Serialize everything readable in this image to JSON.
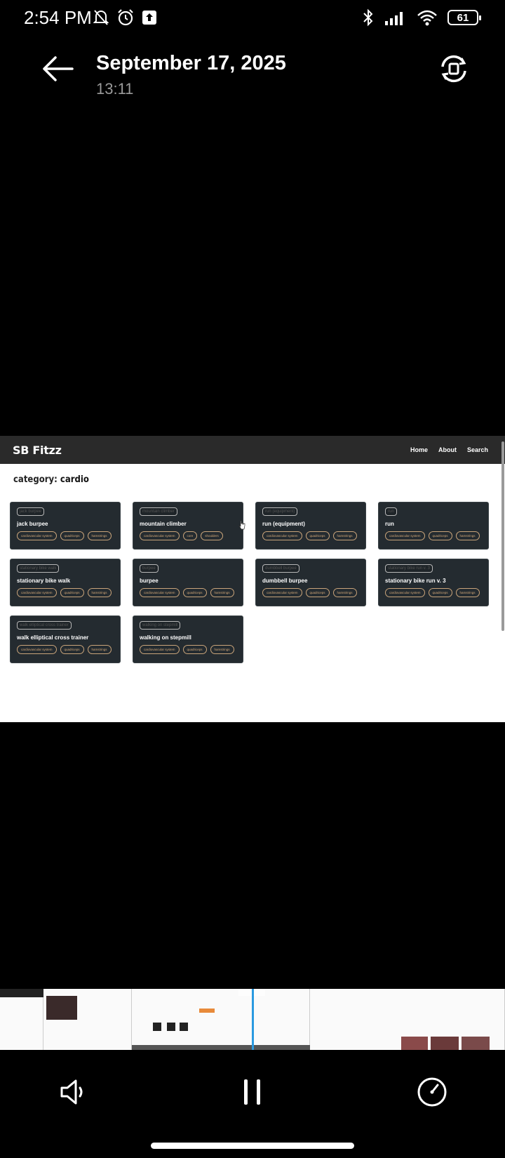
{
  "status_bar": {
    "time": "2:54 PM",
    "battery": "61",
    "icons_left": [
      "mute-bell-icon",
      "alarm-icon",
      "upload-icon"
    ],
    "icons_right": [
      "bluetooth-icon",
      "signal-icon",
      "wifi-icon",
      "battery-icon"
    ]
  },
  "header": {
    "title": "September 17, 2025",
    "subtitle": "13:11",
    "back_icon": "back-arrow-icon",
    "rotate_icon": "rotate-screen-icon"
  },
  "webpage": {
    "brand": "SB Fitzz",
    "nav_links": [
      "Home",
      "About",
      "Search"
    ],
    "category_prefix": "category:",
    "category_name": "cardio",
    "cards": [
      {
        "img_alt": "jack burpee",
        "name": "jack burpee",
        "tags": [
          "cardiovascular system",
          "quadriceps",
          "hamstrings"
        ]
      },
      {
        "img_alt": "mountain climber",
        "name": "mountain climber",
        "tags": [
          "cardiovascular system",
          "core",
          "shoulders"
        ]
      },
      {
        "img_alt": "run (equipment)",
        "name": "run (equipment)",
        "tags": [
          "cardiovascular system",
          "quadriceps",
          "hamstrings"
        ]
      },
      {
        "img_alt": "run",
        "name": "run",
        "tags": [
          "cardiovascular system",
          "quadriceps",
          "hamstrings"
        ]
      },
      {
        "img_alt": "stationary bike walk",
        "name": "stationary bike walk",
        "tags": [
          "cardiovascular system",
          "quadriceps",
          "hamstrings"
        ]
      },
      {
        "img_alt": "burpee",
        "name": "burpee",
        "tags": [
          "cardiovascular system",
          "quadriceps",
          "hamstrings"
        ]
      },
      {
        "img_alt": "dumbbell burpee",
        "name": "dumbbell burpee",
        "tags": [
          "cardiovascular system",
          "quadriceps",
          "hamstrings"
        ]
      },
      {
        "img_alt": "stationary bike run v. 3",
        "name": "stationary bike run v. 3",
        "tags": [
          "cardiovascular system",
          "quadriceps",
          "hamstrings"
        ]
      },
      {
        "img_alt": "walk elliptical cross trainer",
        "name": "walk elliptical cross trainer",
        "tags": [
          "cardiovascular system",
          "quadriceps",
          "hamstrings"
        ]
      },
      {
        "img_alt": "walking on stepmill",
        "name": "walking on stepmill",
        "tags": [
          "cardiovascular system",
          "quadriceps",
          "hamstrings"
        ]
      }
    ]
  },
  "controls": {
    "mute_icon": "speaker-icon",
    "pause_icon": "pause-icon",
    "speed_icon": "speedometer-icon"
  },
  "colors": {
    "background": "#000000",
    "nav_bg": "#2a2a2a",
    "card_bg": "#242b30",
    "tag_color": "#d3a878",
    "playhead": "#2a9ae0"
  }
}
